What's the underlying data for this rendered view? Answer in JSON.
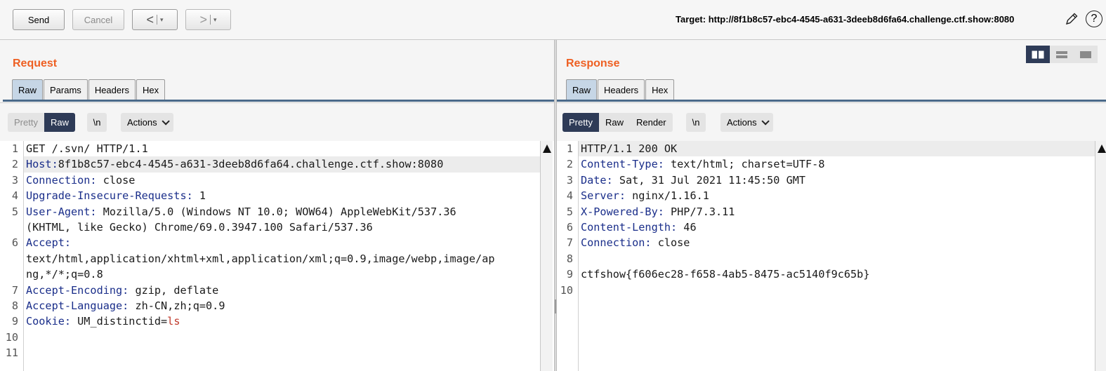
{
  "toolbar": {
    "send_label": "Send",
    "cancel_label": "Cancel",
    "back_glyph": "<",
    "forward_glyph": ">",
    "dropdown_glyph": "▾",
    "target_text": "Target: http://8f1b8c57-ebc4-4545-a631-3deeb8d6fa64.challenge.ctf.show:8080",
    "edit_icon": "pencil-icon",
    "help_glyph": "?"
  },
  "request": {
    "title": "Request",
    "tabs": [
      "Raw",
      "Params",
      "Headers",
      "Hex"
    ],
    "active_tab": "Raw",
    "view_modes": [
      "Pretty",
      "Raw"
    ],
    "active_view": "Raw",
    "newline_label": "\\n",
    "actions_label": "Actions",
    "lines": [
      {
        "n": "1",
        "key": "",
        "val": "GET /.svn/ HTTP/1.1"
      },
      {
        "n": "2",
        "key": "Host:",
        "val": "8f1b8c57-ebc4-4545-a631-3deeb8d6fa64.challenge.ctf.show:8080",
        "highlight": true
      },
      {
        "n": "3",
        "key": "Connection:",
        "val": " close"
      },
      {
        "n": "4",
        "key": "Upgrade-Insecure-Requests:",
        "val": " 1"
      },
      {
        "n": "5",
        "key": "User-Agent:",
        "val": " Mozilla/5.0 (Windows NT 10.0; WOW64) AppleWebKit/537.36"
      },
      {
        "n": "",
        "key": "",
        "val": "(KHTML, like Gecko) Chrome/69.0.3947.100 Safari/537.36"
      },
      {
        "n": "6",
        "key": "Accept:",
        "val": ""
      },
      {
        "n": "",
        "key": "",
        "val": "text/html,application/xhtml+xml,application/xml;q=0.9,image/webp,image/ap"
      },
      {
        "n": "",
        "key": "",
        "val": "ng,*/*;q=0.8"
      },
      {
        "n": "7",
        "key": "Accept-Encoding:",
        "val": " gzip, deflate"
      },
      {
        "n": "8",
        "key": "Accept-Language:",
        "val": " zh-CN,zh;q=0.9"
      },
      {
        "n": "9",
        "key": "Cookie:",
        "val": " UM_distinctid=",
        "red": "ls"
      },
      {
        "n": "10",
        "key": "",
        "val": ""
      },
      {
        "n": "11",
        "key": "",
        "val": ""
      }
    ]
  },
  "response": {
    "title": "Response",
    "tabs": [
      "Raw",
      "Headers",
      "Hex"
    ],
    "active_tab": "Raw",
    "view_modes": [
      "Pretty",
      "Raw",
      "Render"
    ],
    "active_view": "Pretty",
    "newline_label": "\\n",
    "actions_label": "Actions",
    "lines": [
      {
        "n": "1",
        "key": "",
        "val": "HTTP/1.1 200 OK",
        "highlight": true
      },
      {
        "n": "2",
        "key": "Content-Type:",
        "val": " text/html; charset=UTF-8"
      },
      {
        "n": "3",
        "key": "Date:",
        "val": " Sat, 31 Jul 2021 11:45:50 GMT"
      },
      {
        "n": "4",
        "key": "Server:",
        "val": " nginx/1.16.1"
      },
      {
        "n": "5",
        "key": "X-Powered-By:",
        "val": " PHP/7.3.11"
      },
      {
        "n": "6",
        "key": "Content-Length:",
        "val": " 46"
      },
      {
        "n": "7",
        "key": "Connection:",
        "val": " close"
      },
      {
        "n": "8",
        "key": "",
        "val": ""
      },
      {
        "n": "9",
        "key": "",
        "val": "ctfshow{f606ec28-f658-4ab5-8475-ac5140f9c65b}"
      },
      {
        "n": "10",
        "key": "",
        "val": ""
      }
    ]
  },
  "colors": {
    "title_orange": "#ee5f22",
    "header_key_blue": "#1a2e8a",
    "active_segment": "#2e3b57",
    "active_tab": "#c6d6e6"
  }
}
